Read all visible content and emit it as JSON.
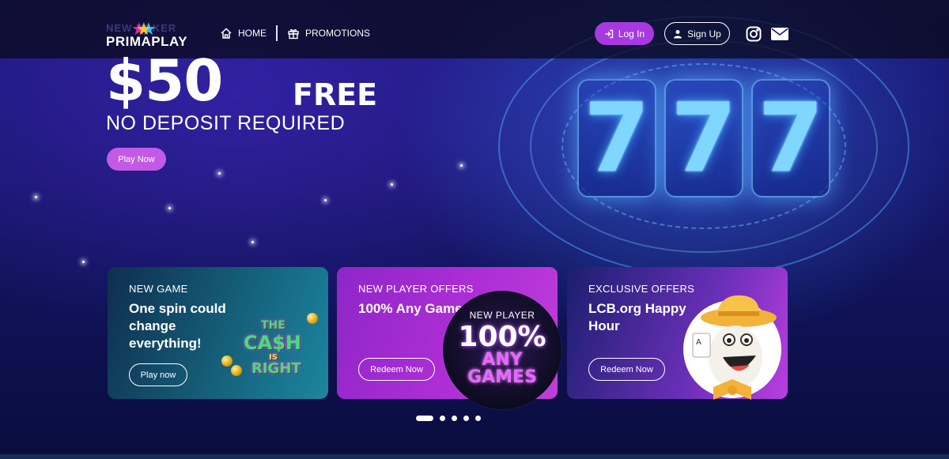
{
  "brand": {
    "top_text": "NEW POKER",
    "name": "PRIMAPLAY"
  },
  "nav": {
    "items": [
      {
        "label": "HOME",
        "icon": "home-icon"
      },
      {
        "label": "PROMOTIONS",
        "icon": "gift-icon"
      }
    ]
  },
  "auth": {
    "login_label": "Log In",
    "signup_label": "Sign Up"
  },
  "social": [
    "instagram-icon",
    "mail-icon"
  ],
  "hero": {
    "amount": "$50",
    "amount_suffix": "FREE",
    "subtitle": "NO DEPOSIT REQUIRED",
    "cta_label": "Play Now",
    "reel_symbols": [
      "7",
      "7",
      "7"
    ]
  },
  "cards": [
    {
      "eyebrow": "NEW GAME",
      "title": "One spin could change everything!",
      "button_label": "Play now",
      "art_text": [
        "THE",
        "CA$H",
        "IS",
        "RIGHT"
      ]
    },
    {
      "eyebrow": "NEW PLAYER OFFERS",
      "title": "100% Any Games",
      "button_label": "Redeem Now",
      "art_text": {
        "small": "NEW PLAYER",
        "big": "100%",
        "line1": "ANY",
        "line2": "GAMES"
      }
    },
    {
      "eyebrow": "EXCLUSIVE OFFERS",
      "title": "LCB.org Happy Hour",
      "button_label": "Redeem Now"
    }
  ],
  "carousel": {
    "total_slides": 5,
    "active_index": 0
  },
  "colors": {
    "accent_purple": "#a63ae0",
    "hero_cta": "#c25ae6",
    "background": "#16166a"
  }
}
